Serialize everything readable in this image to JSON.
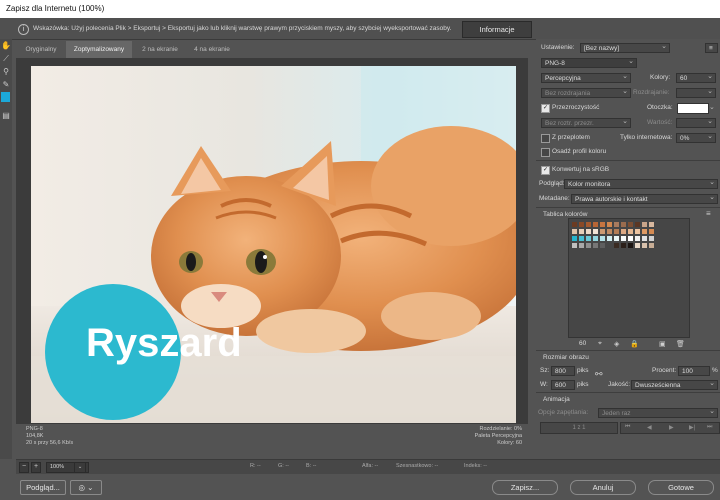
{
  "window": {
    "title": "Zapisz dla Internetu (100%)"
  },
  "hint": {
    "text": "Wskazówka: Użyj polecenia Plik > Eksportuj > Eksportuj jako lub kliknij warstwę prawym przyciskiem myszy, aby szybciej wyeksportować zasoby.",
    "info_tab": "Informacje"
  },
  "tabs": [
    "Oryginalny",
    "Zoptymalizowany",
    "2 na ekranie",
    "4 na ekranie"
  ],
  "image": {
    "badge_text": "Ryszard",
    "badge_color": "#2cb9cf"
  },
  "image_info": {
    "left": [
      "PNG-8",
      "104,8K",
      "20 s przy 56,6 Kb/s"
    ],
    "right": [
      "Rozdzielanie: 0%",
      "Paleta Percepcyjna",
      "Kolory: 60"
    ]
  },
  "status": {
    "zoom": "100%",
    "r": "R: --",
    "g": "G: --",
    "b": "B: --",
    "alpha": "Alfa: --",
    "hex": "Szesnastkowo: --",
    "index": "Indeks: --"
  },
  "panel": {
    "preset_label": "Ustawienie:",
    "preset_value": "[Bez nazwy]",
    "format": "PNG-8",
    "palette": "Percepcyjna",
    "colors_label": "Kolory:",
    "colors_value": "60",
    "dither": "Bez rozdrajania",
    "dither_pct_label": "Rozdrajanie:",
    "transparency": "Przezroczystość",
    "matte_label": "Otoczka:",
    "matte_color": "#ffffff",
    "transp_dither": "Bez roztr. przezr.",
    "amount_label": "Wartość:",
    "interlaced": "Z przeplotem",
    "web_snap_label": "Tylko internetowa:",
    "web_snap_value": "0%",
    "embed_profile": "Osadź profil koloru",
    "convert_srgb": "Konwertuj na sRGB",
    "preview_label": "Podgląd:",
    "preview_value": "Kolor monitora",
    "metadata_label": "Metadane:",
    "metadata_value": "Prawa autorskie i kontakt",
    "color_table_label": "Tablica kolorów",
    "color_count": "60",
    "image_size_label": "Rozmiar obrazu",
    "w_label": "Sz:",
    "w_value": "800",
    "h_label": "W:",
    "h_value": "600",
    "px": "piks",
    "percent_label": "Procent:",
    "percent_value": "100",
    "percent_unit": "%",
    "quality_label": "Jakość:",
    "quality_value": "Dwusześcienna",
    "animation_label": "Animacja",
    "loop_label": "Opcje zapętlania:",
    "loop_value": "Jeden raz",
    "frame_counter": "1 z 1"
  },
  "buttons": {
    "preview": "Podgląd...",
    "save": "Zapisz...",
    "cancel": "Anuluj",
    "done": "Gotowe"
  },
  "swatches": [
    "#6b3b22",
    "#8a4a27",
    "#a55a2e",
    "#b86636",
    "#c77540",
    "#d2874e",
    "#a87b5e",
    "#9a6c4e",
    "#7c4f34",
    "#5b3724",
    "#c9a58a",
    "#d8b89e",
    "#e1c3a9",
    "#e8cfb8",
    "#efdac7",
    "#f3e4d5",
    "#cd9a72",
    "#bf8a62",
    "#b27c56",
    "#dca883",
    "#e5b690",
    "#ecc3a0",
    "#e09a63",
    "#d48a52",
    "#26b4cc",
    "#48c0d3",
    "#6ccad8",
    "#94d6df",
    "#b5e2e8",
    "#d3eef1",
    "#e9f6f7",
    "#f7fbfb",
    "#ffffff",
    "#f2f2f2",
    "#e2e2e2",
    "#d2d2d2",
    "#c0c0c0",
    "#a9a9a9",
    "#8f8f8f",
    "#777777",
    "#5e5e5e",
    "#464646",
    "#3a2b22",
    "#2c201a",
    "#1b1411",
    "#ead9c8",
    "#d9c2ad",
    "#c8ad95"
  ]
}
